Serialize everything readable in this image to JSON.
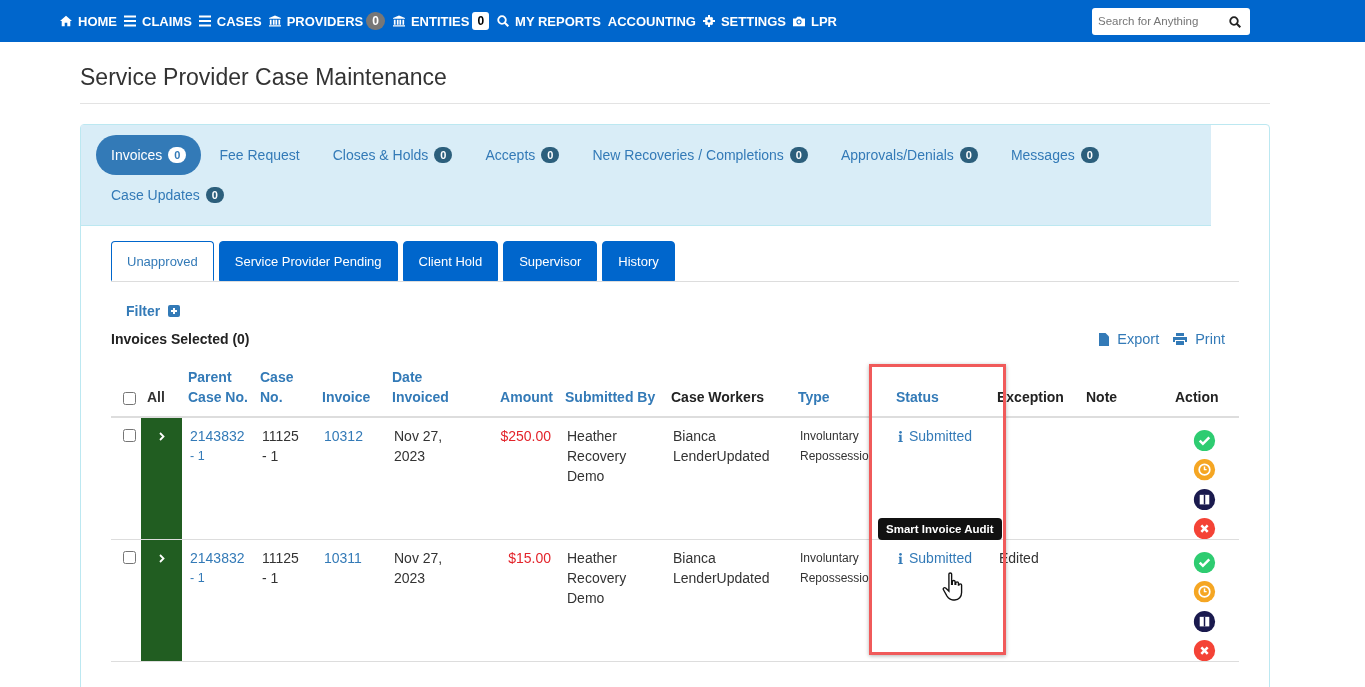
{
  "nav": {
    "items": [
      {
        "label": "HOME"
      },
      {
        "label": "CLAIMS"
      },
      {
        "label": "CASES"
      },
      {
        "label": "PROVIDERS",
        "badge": "0",
        "kind": "grey"
      },
      {
        "label": "ENTITIES",
        "badge": "0",
        "kind": "white"
      },
      {
        "label": "MY REPORTS"
      },
      {
        "label": "ACCOUNTING"
      },
      {
        "label": "SETTINGS"
      },
      {
        "label": "LPR"
      }
    ],
    "search": {
      "placeholder": "Search for Anything"
    }
  },
  "page_title": "Service Provider Case Maintenance",
  "tabs": [
    {
      "label": "Invoices",
      "badge": "0",
      "selected": true
    },
    {
      "label": "Fee Request",
      "selected": false
    },
    {
      "label": "Closes & Holds",
      "badge": "0",
      "selected": false
    },
    {
      "label": "Accepts",
      "badge": "0",
      "selected": false
    },
    {
      "label": "New Recoveries / Completions",
      "badge": "0",
      "selected": false
    },
    {
      "label": "Approvals/Denials",
      "badge": "0",
      "selected": false
    },
    {
      "label": "Messages",
      "badge": "0",
      "selected": false
    },
    {
      "label": "Case Updates",
      "badge": "0",
      "selected": false
    }
  ],
  "subtabs": [
    {
      "label": "Unapproved",
      "selected": true
    },
    {
      "label": "Service Provider Pending",
      "selected": false
    },
    {
      "label": "Client Hold",
      "selected": false
    },
    {
      "label": "Supervisor",
      "selected": false
    },
    {
      "label": "History",
      "selected": false
    }
  ],
  "filter": "Filter",
  "selected_count": "Invoices Selected (0)",
  "export": "Export",
  "print": "Print",
  "table": {
    "all_checked": false,
    "all_label": "All",
    "columns": [
      {
        "label": "Parent Case No.",
        "sortable": true
      },
      {
        "label": "Case No.",
        "sortable": true
      },
      {
        "label": "Invoice",
        "sortable": true
      },
      {
        "label": "Date Invoiced",
        "sortable": true
      },
      {
        "label": "Amount",
        "sortable": true
      },
      {
        "label": "Submitted By",
        "sortable": true
      },
      {
        "label": "Case Workers",
        "sortable": false
      },
      {
        "label": "Type",
        "sortable": true
      },
      {
        "label": "Status",
        "sortable": true
      },
      {
        "label": "Exception",
        "sortable": false
      },
      {
        "label": "Note",
        "sortable": false
      },
      {
        "label": "Action",
        "sortable": false
      }
    ],
    "rows": [
      {
        "checked": false,
        "parent": [
          "2143832",
          "- 1"
        ],
        "case": [
          "11125",
          "- 1"
        ],
        "invoice": "10312",
        "date": [
          "Nov 27,",
          "2023"
        ],
        "amount": "$250.00",
        "submitted_by": [
          "Heather",
          "Recovery",
          "Demo"
        ],
        "workers": [
          "Bianca",
          "LenderUpdated"
        ],
        "type": [
          "Involuntary",
          "Repossessio"
        ],
        "status": "Submitted"
      },
      {
        "checked": false,
        "parent": [
          "2143832",
          "- 1"
        ],
        "case": [
          "11125",
          "- 1"
        ],
        "invoice": "10311",
        "date": [
          "Nov 27,",
          "2023"
        ],
        "amount": "$15.00",
        "submitted_by": [
          "Heather",
          "Recovery",
          "Demo"
        ],
        "workers": [
          "Bianca",
          "LenderUpdated"
        ],
        "type": [
          "Involuntary",
          "Repossessio"
        ],
        "status": "Submitted",
        "tooltip": "Smart Invoice Audit",
        "exception": "Edited"
      }
    ]
  }
}
